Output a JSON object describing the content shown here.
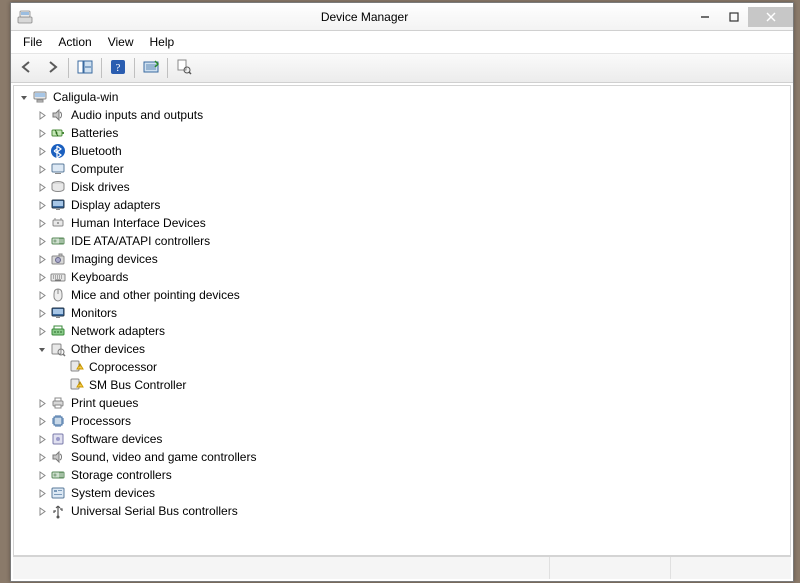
{
  "window": {
    "title": "Device Manager",
    "icon": "computer-icon"
  },
  "menubar": {
    "items": [
      {
        "label": "File"
      },
      {
        "label": "Action"
      },
      {
        "label": "View"
      },
      {
        "label": "Help"
      }
    ]
  },
  "toolbar": {
    "items": [
      {
        "icon": "back-icon",
        "name": "back-button"
      },
      {
        "icon": "forward-icon",
        "name": "forward-button"
      },
      {
        "sep": true
      },
      {
        "icon": "show-hide-console-icon",
        "name": "show-hide-button"
      },
      {
        "sep": true
      },
      {
        "icon": "help-icon",
        "name": "help-button"
      },
      {
        "sep": true
      },
      {
        "icon": "scan-hardware-icon",
        "name": "scan-button"
      },
      {
        "sep": true
      },
      {
        "icon": "properties-icon",
        "name": "properties-button"
      }
    ]
  },
  "tree": {
    "root": {
      "label": "Caligula-win",
      "icon": "computer-icon",
      "expanded": true,
      "children": [
        {
          "label": "Audio inputs and outputs",
          "icon": "audio-icon",
          "expanded": false
        },
        {
          "label": "Batteries",
          "icon": "battery-icon",
          "expanded": false
        },
        {
          "label": "Bluetooth",
          "icon": "bluetooth-icon",
          "expanded": false
        },
        {
          "label": "Computer",
          "icon": "computer-small-icon",
          "expanded": false
        },
        {
          "label": "Disk drives",
          "icon": "disk-icon",
          "expanded": false
        },
        {
          "label": "Display adapters",
          "icon": "display-icon",
          "expanded": false
        },
        {
          "label": "Human Interface Devices",
          "icon": "hid-icon",
          "expanded": false
        },
        {
          "label": "IDE ATA/ATAPI controllers",
          "icon": "ide-icon",
          "expanded": false
        },
        {
          "label": "Imaging devices",
          "icon": "imaging-icon",
          "expanded": false
        },
        {
          "label": "Keyboards",
          "icon": "keyboard-icon",
          "expanded": false
        },
        {
          "label": "Mice and other pointing devices",
          "icon": "mouse-icon",
          "expanded": false
        },
        {
          "label": "Monitors",
          "icon": "monitor-icon",
          "expanded": false
        },
        {
          "label": "Network adapters",
          "icon": "network-icon",
          "expanded": false
        },
        {
          "label": "Other devices",
          "icon": "other-icon",
          "expanded": true,
          "children": [
            {
              "label": "Coprocessor",
              "icon": "warning-device-icon",
              "leaf": true
            },
            {
              "label": "SM Bus Controller",
              "icon": "warning-device-icon",
              "leaf": true
            }
          ]
        },
        {
          "label": "Print queues",
          "icon": "printer-icon",
          "expanded": false
        },
        {
          "label": "Processors",
          "icon": "processor-icon",
          "expanded": false
        },
        {
          "label": "Software devices",
          "icon": "software-icon",
          "expanded": false
        },
        {
          "label": "Sound, video and game controllers",
          "icon": "sound-icon",
          "expanded": false
        },
        {
          "label": "Storage controllers",
          "icon": "storage-icon",
          "expanded": false
        },
        {
          "label": "System devices",
          "icon": "system-icon",
          "expanded": false
        },
        {
          "label": "Universal Serial Bus controllers",
          "icon": "usb-icon",
          "expanded": false
        }
      ]
    }
  }
}
